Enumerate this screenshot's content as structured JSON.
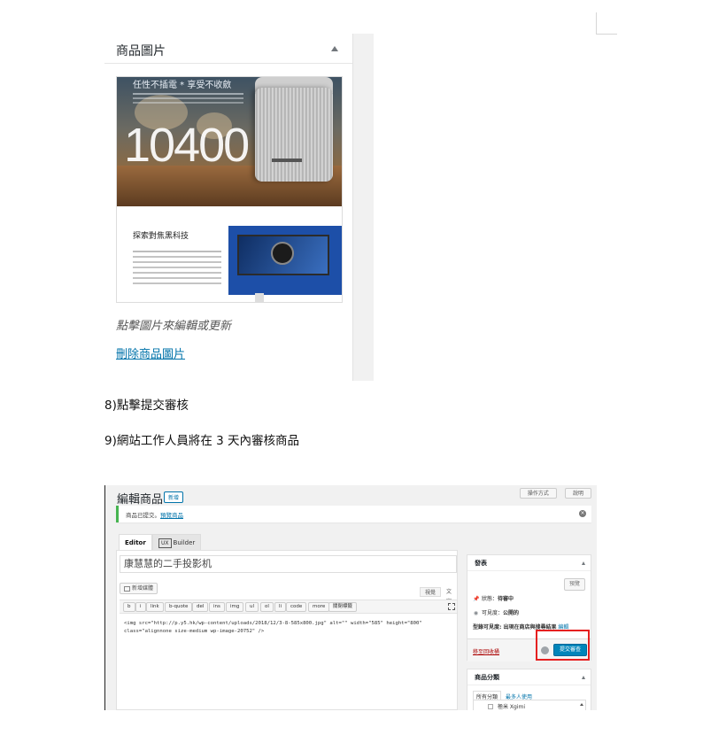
{
  "product_image_box": {
    "title": "商品圖片",
    "image": {
      "headline": "任性不插電 * 享受不收斂",
      "big_number": "10400",
      "lower_heading": "探索對焦黑科技"
    },
    "hint": "點擊圖片來編輯或更新",
    "remove_link": "刪除商品圖片"
  },
  "steps": {
    "step8": "8)點擊提交審核",
    "step9": "9)網站工作人員將在 3 天內審核商品"
  },
  "editor_screenshot": {
    "heading": "編輯商品",
    "add_new_label": "新增",
    "top_buttons": [
      "操作方式",
      "說明"
    ],
    "notice": {
      "text": "商品已提交。",
      "link": "預覽商品",
      "dismiss_icon": "close-circle-icon"
    },
    "tabs": {
      "editor": "Editor",
      "ux_box": "UX",
      "ux_builder": "Builder"
    },
    "title_value": "康慧慧的二手投影机",
    "add_media_label": "新增媒體",
    "view_tabs": {
      "visual": "視覺",
      "text": "文字"
    },
    "quicktags": [
      "b",
      "i",
      "link",
      "b-quote",
      "del",
      "ins",
      "img",
      "ul",
      "ol",
      "li",
      "code",
      "more",
      "關閉標籤"
    ],
    "code_lines": [
      "<img src=\"http://p.y5.hk/wp-content/uploads/2018/12/3-8-585x800.jpg\" alt=\"\" width=\"585\" height=\"800\"",
      "class=\"alignnone size-medium wp-image-20752\" />"
    ],
    "publish_box": {
      "title": "發表",
      "preview_label": "預覽",
      "status_label": "狀態：",
      "status_value": "待審中",
      "visibility_label": "可見度：",
      "visibility_value": "公開的",
      "catalog_visibility": "型錄可見度: 出現在商店與搜尋結果",
      "edit_link": "編輯",
      "trash_link": "移至回收桶",
      "submit_label": "提交審查"
    },
    "category_box": {
      "title": "商品分類",
      "tab_all": "所有分類",
      "tab_popular": "最多人使用",
      "first_item": "極米 Xgimi"
    }
  },
  "colors": {
    "link_blue": "#0073aa",
    "primary_button": "#0085ba",
    "notice_green": "#46b450",
    "highlight_red": "#e52020",
    "trash_red": "#aa0000"
  }
}
